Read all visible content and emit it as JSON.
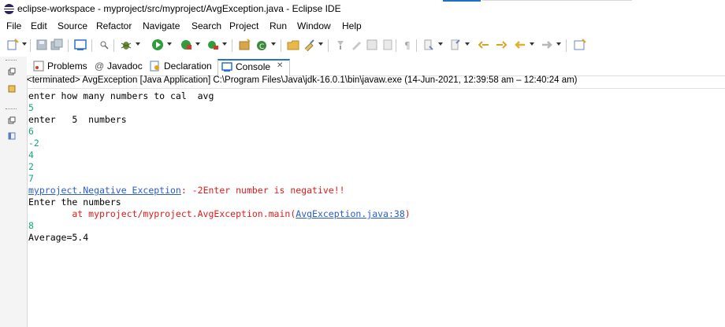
{
  "window": {
    "title": "eclipse-workspace - myproject/src/myproject/AvgException.java - Eclipse IDE"
  },
  "menu": [
    "File",
    "Edit",
    "Source",
    "Refactor",
    "Navigate",
    "Search",
    "Project",
    "Run",
    "Window",
    "Help"
  ],
  "tabs": {
    "problems": "Problems",
    "javadoc": "Javadoc",
    "declaration": "Declaration",
    "console": "Console",
    "console_close": "✕"
  },
  "console": {
    "status": "<terminated> AvgException [Java Application] C:\\Program Files\\Java\\jdk-16.0.1\\bin\\javaw.exe  (14-Jun-2021, 12:39:58 am – 12:40:24 am)",
    "lines": {
      "l1": "enter how many numbers to cal  avg",
      "l2": "5",
      "l3": "enter   5  numbers",
      "l4": "6",
      "l5": "-2",
      "l6": "4",
      "l7": "2",
      "l8": "7",
      "l9_link": "myproject.Negative Exception",
      "l9_rest": ": -2Enter number is negative!!",
      "l10": "Enter the numbers",
      "l11_prefix": "        at myproject/myproject.AvgException.main(",
      "l11_link": "AvgException.java:38",
      "l11_suffix": ")",
      "l12": "8",
      "l13": "Average=5.4"
    }
  },
  "colors": {
    "input_text": "#13a878",
    "error_text": "#e01b1b",
    "link_text": "#2a5ccd",
    "active_tab_accent": "#2a6fd6"
  },
  "icons": [
    "eclipse-icon",
    "new-icon",
    "save-icon",
    "save-all-icon",
    "terminal-icon",
    "debug-icon",
    "run-icon",
    "coverage-icon",
    "run-external-icon",
    "new-package-icon",
    "new-class-icon",
    "open-type-icon",
    "search-icon",
    "toggle-mark-icon",
    "pin-icon",
    "next-annotation-icon",
    "previous-annotation-icon",
    "back-icon",
    "forward-icon",
    "perspective-icon"
  ]
}
